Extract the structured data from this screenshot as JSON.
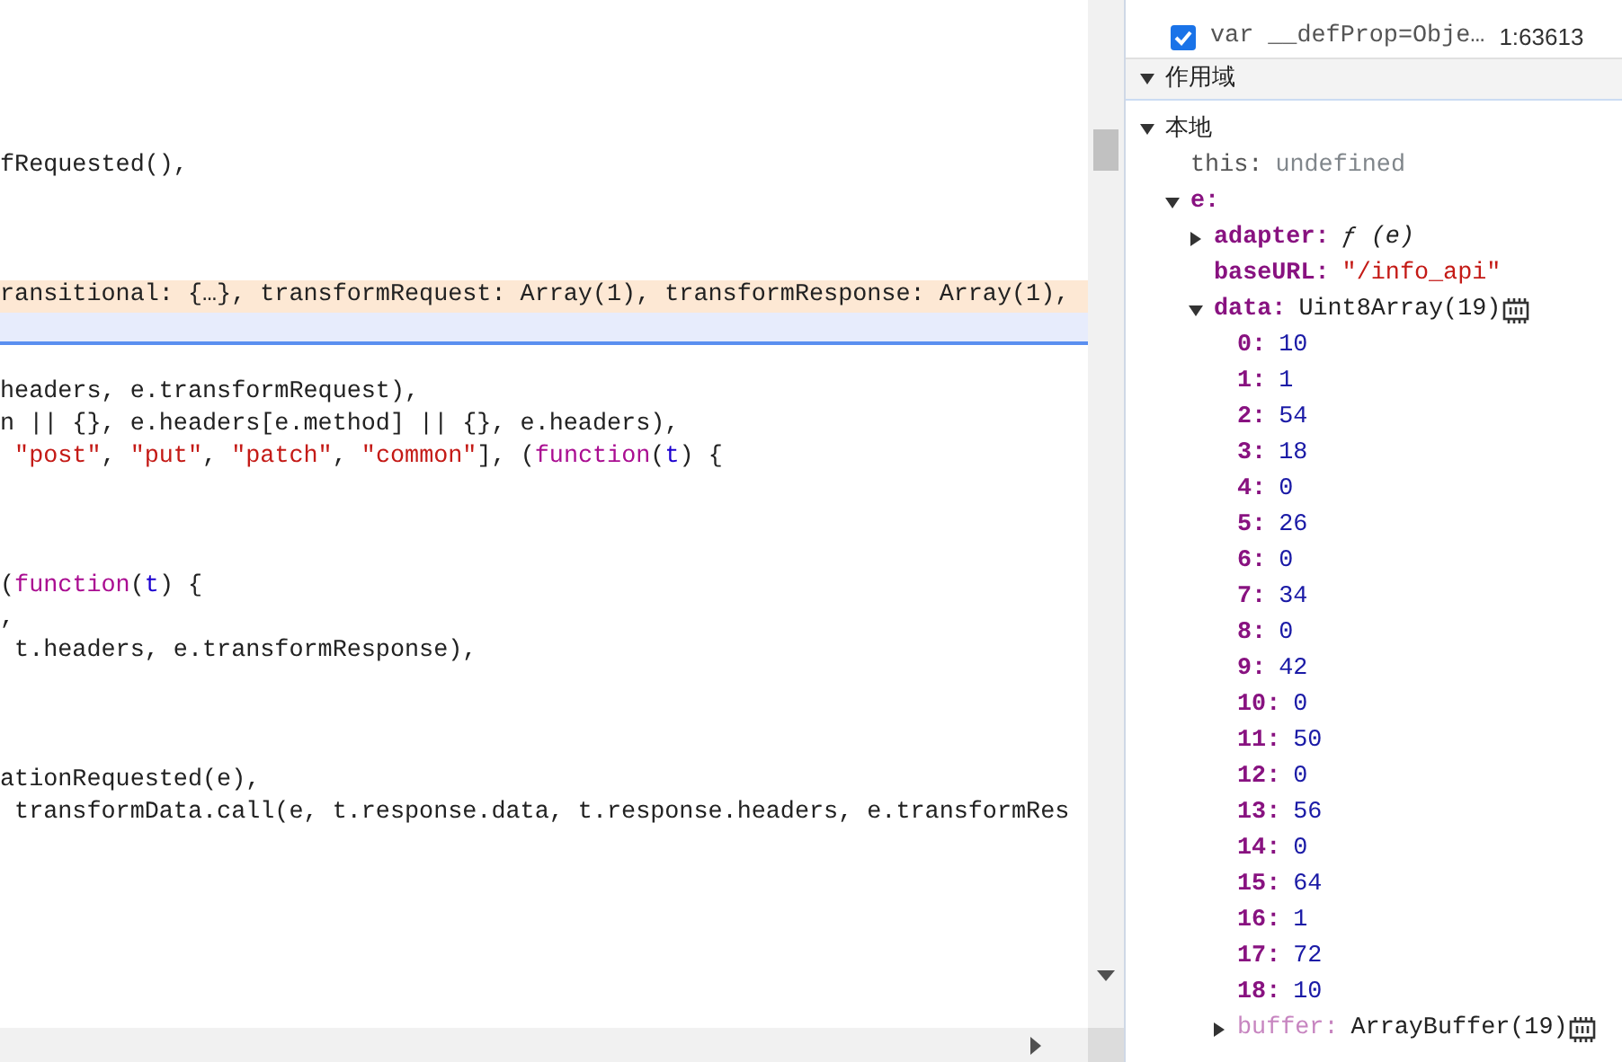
{
  "editor": {
    "lines": [
      {
        "paused": false,
        "selected": false
      },
      {
        "paused": false,
        "selected": false
      },
      {
        "paused": false,
        "selected": false
      },
      {
        "paused": false,
        "selected": false
      },
      {
        "paused": false,
        "selected": false,
        "tokens": [
          {
            "text": "fRequested(),",
            "kind": "plain"
          }
        ]
      },
      {
        "paused": false,
        "selected": false
      },
      {
        "paused": false,
        "selected": false
      },
      {
        "paused": false,
        "selected": false
      },
      {
        "paused": true,
        "selected": false,
        "tokens": [
          {
            "text": "ransitional: {…}, transformRequest: Array(1), transformResponse: Array(1),",
            "kind": "plain"
          }
        ]
      },
      {
        "paused": false,
        "selected": true
      },
      {
        "paused": false,
        "selected": false
      },
      {
        "paused": false,
        "selected": false,
        "tokens": [
          {
            "text": "headers, e.transformRequest),",
            "kind": "plain"
          }
        ]
      },
      {
        "paused": false,
        "selected": false,
        "tokens": [
          {
            "text": "n || {}, e.headers[e.method] || {}, e.headers),",
            "kind": "plain"
          }
        ]
      },
      {
        "paused": false,
        "selected": false,
        "tokens": [
          {
            "text": " \"post\"",
            "kind": "string"
          },
          {
            "text": ", ",
            "kind": "plain"
          },
          {
            "text": "\"put\"",
            "kind": "string"
          },
          {
            "text": ", ",
            "kind": "plain"
          },
          {
            "text": "\"patch\"",
            "kind": "string"
          },
          {
            "text": ", ",
            "kind": "plain"
          },
          {
            "text": "\"common\"",
            "kind": "string"
          },
          {
            "text": "], (",
            "kind": "plain"
          },
          {
            "text": "function",
            "kind": "keyword"
          },
          {
            "text": "(",
            "kind": "plain"
          },
          {
            "text": "t",
            "kind": "param"
          },
          {
            "text": ") {",
            "kind": "plain"
          }
        ]
      },
      {
        "paused": false,
        "selected": false
      },
      {
        "paused": false,
        "selected": false
      },
      {
        "paused": false,
        "selected": false
      },
      {
        "paused": false,
        "selected": false,
        "tokens": [
          {
            "text": "(",
            "kind": "plain"
          },
          {
            "text": "function",
            "kind": "keyword"
          },
          {
            "text": "(",
            "kind": "plain"
          },
          {
            "text": "t",
            "kind": "param"
          },
          {
            "text": ") {",
            "kind": "plain"
          }
        ]
      },
      {
        "paused": false,
        "selected": false,
        "tokens": [
          {
            "text": ",",
            "kind": "plain"
          }
        ]
      },
      {
        "paused": false,
        "selected": false,
        "tokens": [
          {
            "text": " t.headers, e.transformResponse),",
            "kind": "plain"
          }
        ]
      },
      {
        "paused": false,
        "selected": false
      },
      {
        "paused": false,
        "selected": false
      },
      {
        "paused": false,
        "selected": false
      },
      {
        "paused": false,
        "selected": false,
        "tokens": [
          {
            "text": "ationRequested(e),",
            "kind": "plain"
          }
        ]
      },
      {
        "paused": false,
        "selected": false,
        "tokens": [
          {
            "text": " transformData.call(e, t.response.data, t.response.headers, e.transformRes",
            "kind": "plain"
          }
        ]
      }
    ]
  },
  "breakpoints": [
    {
      "checked": true,
      "code": "var __defProp=Obje…",
      "location": "1:63613"
    }
  ],
  "scope": {
    "title": "作用域",
    "expanded": true,
    "groups": [
      {
        "title": "本地",
        "expanded": true,
        "children": [
          {
            "name": "this:",
            "own": false,
            "inherited": false,
            "value": "undefined",
            "kind": "missing"
          },
          {
            "name": "e:",
            "own": true,
            "inherited": false,
            "expanded": true,
            "children": [
              {
                "name": "adapter:",
                "own": true,
                "inherited": false,
                "value": "ƒ (e)",
                "kind": "function",
                "expanded": false
              },
              {
                "name": "baseURL:",
                "own": true,
                "inherited": false,
                "value": "\"/info_api\"",
                "kind": "string"
              },
              {
                "name": "data:",
                "own": true,
                "inherited": false,
                "value": "Uint8Array(19)",
                "kind": "type",
                "memory": true,
                "expanded": true,
                "children": [
                  {
                    "name": "0:",
                    "own": true,
                    "inherited": false,
                    "value": "10",
                    "kind": "number"
                  },
                  {
                    "name": "1:",
                    "own": true,
                    "inherited": false,
                    "value": "1",
                    "kind": "number"
                  },
                  {
                    "name": "2:",
                    "own": true,
                    "inherited": false,
                    "value": "54",
                    "kind": "number"
                  },
                  {
                    "name": "3:",
                    "own": true,
                    "inherited": false,
                    "value": "18",
                    "kind": "number"
                  },
                  {
                    "name": "4:",
                    "own": true,
                    "inherited": false,
                    "value": "0",
                    "kind": "number"
                  },
                  {
                    "name": "5:",
                    "own": true,
                    "inherited": false,
                    "value": "26",
                    "kind": "number"
                  },
                  {
                    "name": "6:",
                    "own": true,
                    "inherited": false,
                    "value": "0",
                    "kind": "number"
                  },
                  {
                    "name": "7:",
                    "own": true,
                    "inherited": false,
                    "value": "34",
                    "kind": "number"
                  },
                  {
                    "name": "8:",
                    "own": true,
                    "inherited": false,
                    "value": "0",
                    "kind": "number"
                  },
                  {
                    "name": "9:",
                    "own": true,
                    "inherited": false,
                    "value": "42",
                    "kind": "number"
                  },
                  {
                    "name": "10:",
                    "own": true,
                    "inherited": false,
                    "value": "0",
                    "kind": "number"
                  },
                  {
                    "name": "11:",
                    "own": true,
                    "inherited": false,
                    "value": "50",
                    "kind": "number"
                  },
                  {
                    "name": "12:",
                    "own": true,
                    "inherited": false,
                    "value": "0",
                    "kind": "number"
                  },
                  {
                    "name": "13:",
                    "own": true,
                    "inherited": false,
                    "value": "56",
                    "kind": "number"
                  },
                  {
                    "name": "14:",
                    "own": true,
                    "inherited": false,
                    "value": "0",
                    "kind": "number"
                  },
                  {
                    "name": "15:",
                    "own": true,
                    "inherited": false,
                    "value": "64",
                    "kind": "number"
                  },
                  {
                    "name": "16:",
                    "own": true,
                    "inherited": false,
                    "value": "1",
                    "kind": "number"
                  },
                  {
                    "name": "17:",
                    "own": true,
                    "inherited": false,
                    "value": "72",
                    "kind": "number"
                  },
                  {
                    "name": "18:",
                    "own": true,
                    "inherited": false,
                    "value": "10",
                    "kind": "number"
                  },
                  {
                    "name": "buffer:",
                    "own": false,
                    "inherited": true,
                    "value": "ArrayBuffer(19)",
                    "kind": "type",
                    "memory": true,
                    "expanded": false
                  }
                ]
              }
            ]
          }
        ]
      }
    ]
  }
}
